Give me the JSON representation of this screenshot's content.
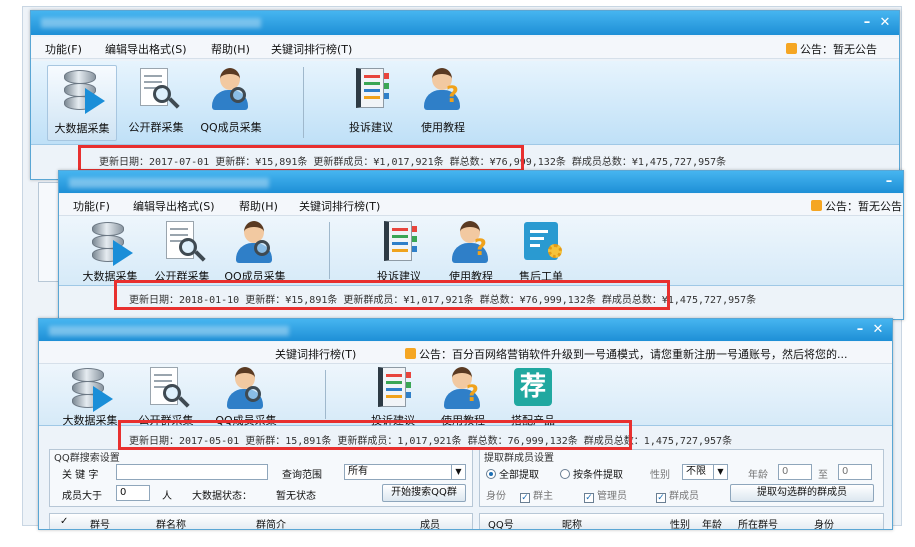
{
  "menu": {
    "items": [
      "功能(F)",
      "编辑导出格式(S)",
      "帮助(H)",
      "关键词排行榜(T)"
    ],
    "notice_label": "公告：",
    "notice_text_1": "暂无公告",
    "notice_text_2": "暂无公告",
    "notice_text_3": "百分百网络营销软件升级到一号通模式，请您重新注册一号通账号，然后将您的..."
  },
  "toolbar": {
    "big_data": "大数据采集",
    "public_group": "公开群采集",
    "qq_member": "QQ成员采集",
    "qq_member_alt": "QQ成员采集",
    "complaint": "投诉建议",
    "tutorial": "使用教程",
    "after_sales": "售后工单",
    "products": "搭配产品"
  },
  "status": {
    "line1": "更新日期：2017-07-01 更新群：¥15,891条 更新群成员：¥1,017,921条 群总数：¥76,999,132条 群成员总数：¥1,475,727,957条",
    "line2": "更新日期：2018-01-10 更新群：¥15,891条 更新群成员：¥1,017,921条 群总数：¥76,999,132条 群成员总数：¥1,475,727,957条",
    "line3": "更新日期：2017-05-01 更新群：15,891条 更新群成员：1,017,921条 群总数：76,999,132条 群成员总数：1,475,727,957条"
  },
  "search": {
    "group_title": "QQ群搜索设置",
    "keyword_label": "关 键 字",
    "keyword_value": "",
    "range_label": "查询范围",
    "range_value": "所有",
    "members_label": "成员大于",
    "members_value": "0",
    "people_unit": "人",
    "bigdata_label": "大数据状态：",
    "bigdata_value": "暂无状态",
    "start_button": "开始搜索QQ群"
  },
  "extract": {
    "group_title": "提取群成员设置",
    "all_label": "全部提取",
    "cond_label": "按条件提取",
    "gender_label": "性别",
    "gender_value": "不限",
    "age_label": "年龄",
    "age_from": "0",
    "age_to_label": "至",
    "age_to": "0",
    "identity_label": "身份",
    "owner_label": "群主",
    "admin_label": "管理员",
    "member_label": "群成员",
    "extract_button": "提取勾选群的群成员"
  },
  "left_table": {
    "columns": [
      "✓",
      "群号",
      "群名称",
      "群简介",
      "成员"
    ]
  },
  "right_table": {
    "columns": [
      "QQ号",
      "昵称",
      "性别",
      "年龄",
      "所在群号",
      "身份"
    ]
  },
  "colors": {
    "highlight": "#e8302f",
    "title_bar": "#1e8fd6",
    "toolbar": "#bfe0f7"
  }
}
